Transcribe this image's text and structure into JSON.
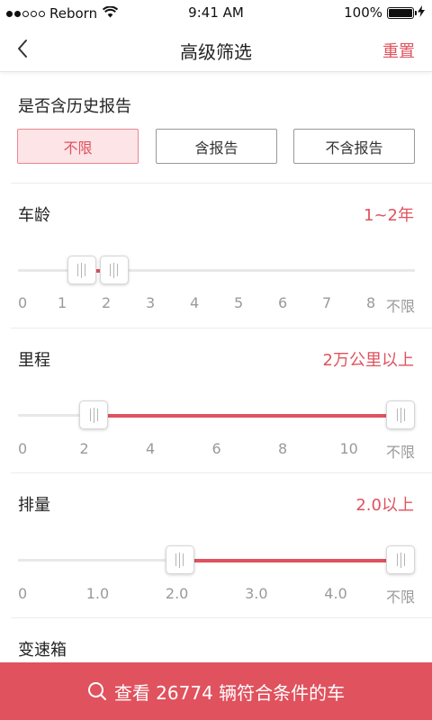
{
  "status_bar": {
    "carrier": "Reborn",
    "time": "9:41 AM",
    "battery": "100%",
    "signal_bars_filled": 2,
    "signal_bars_total": 5
  },
  "nav": {
    "title": "高级筛选",
    "reset_label": "重置",
    "back_icon": "chevron-left-icon"
  },
  "history_report": {
    "label": "是否含历史报告",
    "options": [
      "不限",
      "含报告",
      "不含报告"
    ],
    "selected": "不限"
  },
  "age": {
    "label": "车龄",
    "value": "1~2年",
    "ticks": [
      "0",
      "1",
      "2",
      "3",
      "4",
      "5",
      "6",
      "7",
      "8",
      "不限"
    ],
    "range_index": [
      1.2,
      2.0
    ]
  },
  "mileage": {
    "label": "里程",
    "value": "2万公里以上",
    "ticks": [
      "0",
      "2",
      "4",
      "6",
      "8",
      "10",
      "不限"
    ],
    "range_index": [
      1,
      6
    ]
  },
  "displacement": {
    "label": "排量",
    "value": "2.0以上",
    "ticks": [
      "0",
      "1.0",
      "2.0",
      "3.0",
      "4.0",
      "不限"
    ],
    "range_index": [
      2,
      5
    ]
  },
  "gearbox": {
    "label": "变速箱"
  },
  "bottom_bar": {
    "text": "查看 26774 辆符合条件的车",
    "icon": "search-icon"
  },
  "colors": {
    "accent": "#e0525e",
    "active_bg": "#fde4e6",
    "track": "#e8e8e8",
    "tick_text": "#9a9a9a"
  }
}
